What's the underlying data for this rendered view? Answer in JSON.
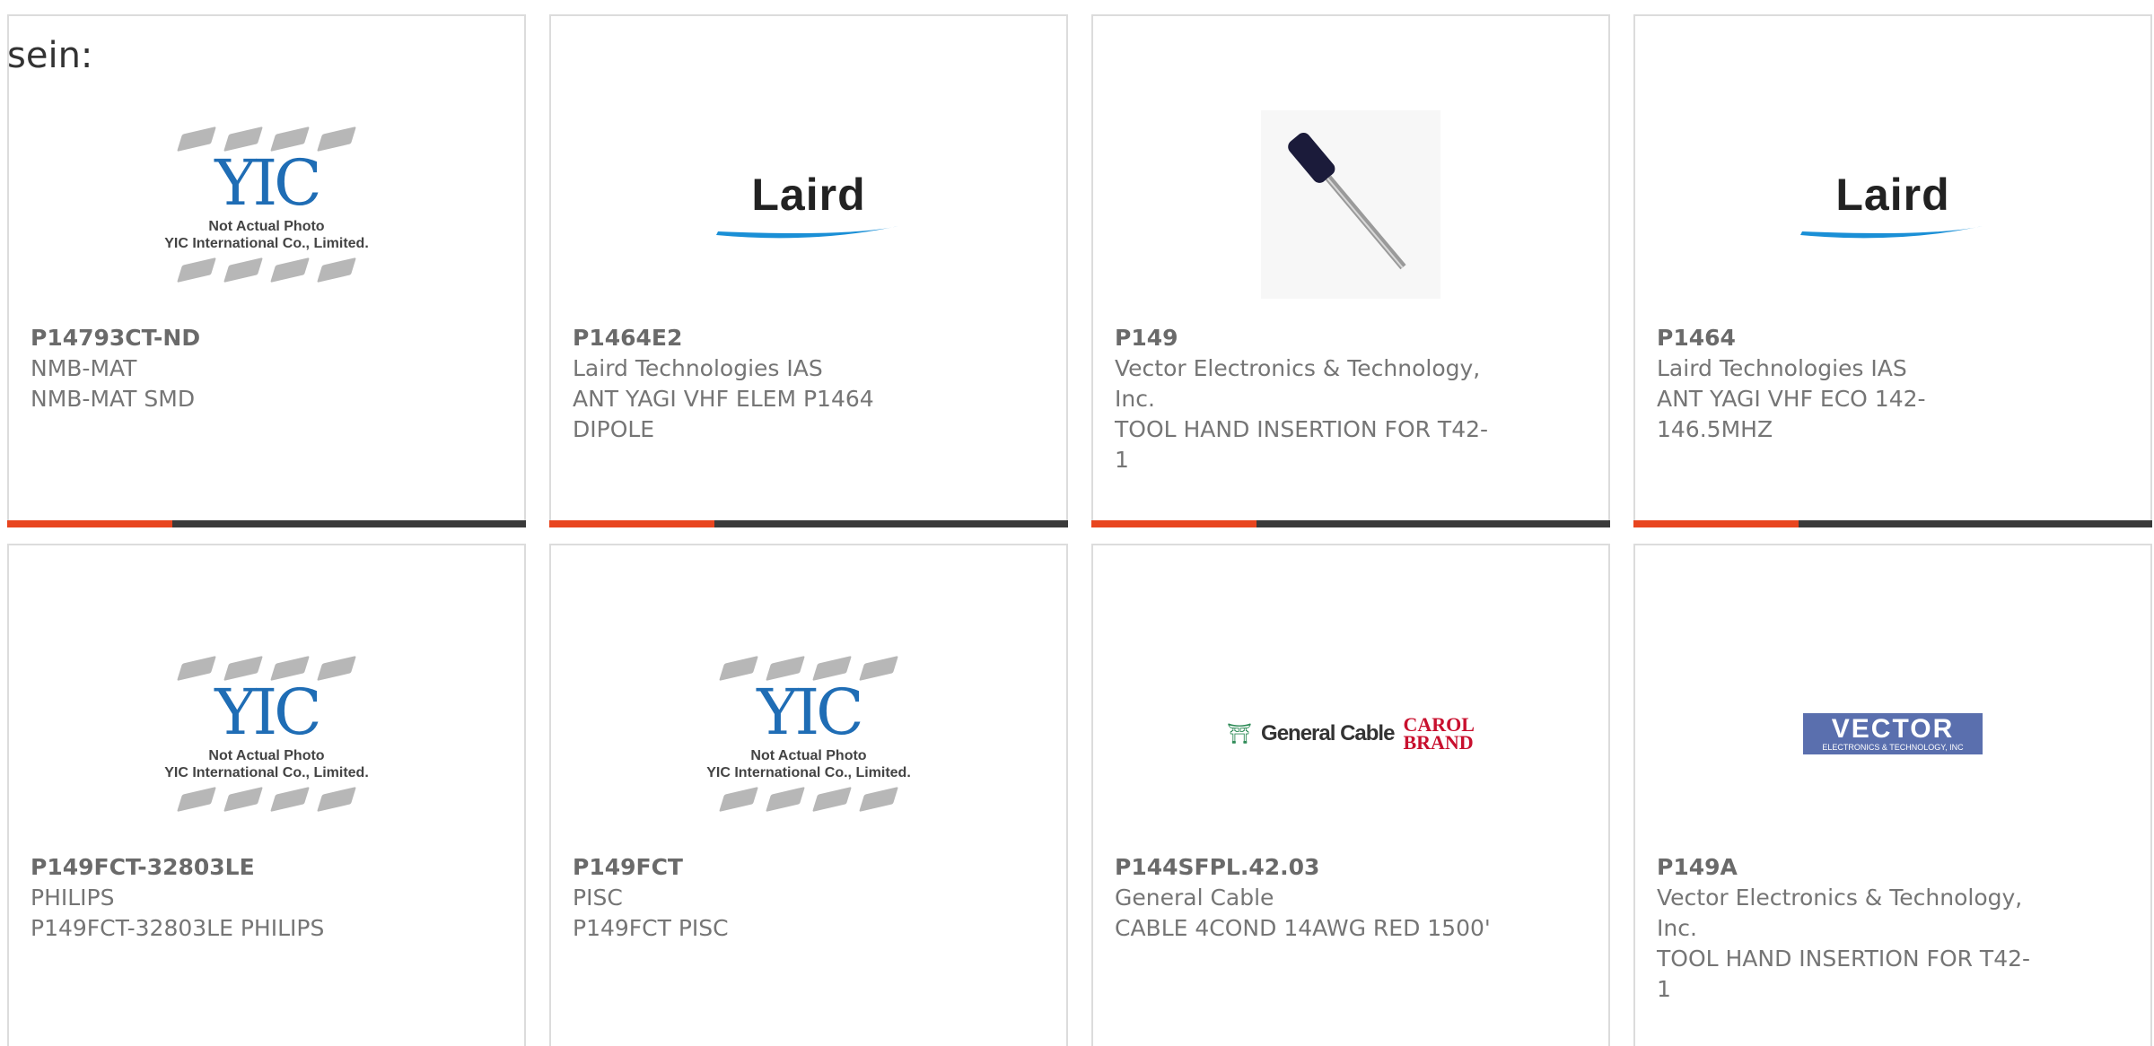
{
  "page_label": "sein:",
  "colors": {
    "accent": "#e8451f",
    "bar": "#3a3a3a",
    "border": "#dcdcdc",
    "text": "#757575"
  },
  "products": [
    {
      "part_number": "P14793CT-ND",
      "manufacturer": "NMB-MAT",
      "description": "NMB-MAT SMD",
      "image": "yic-placeholder"
    },
    {
      "part_number": "P1464E2",
      "manufacturer": "Laird Technologies IAS",
      "description": "ANT YAGI VHF ELEM P1464 DIPOLE",
      "image": "laird-logo"
    },
    {
      "part_number": "P149",
      "manufacturer": "Vector Electronics & Technology, Inc.",
      "description": "TOOL HAND INSERTION FOR T42-1",
      "image": "insertion-tool-photo"
    },
    {
      "part_number": "P1464",
      "manufacturer": "Laird Technologies IAS",
      "description": "ANT YAGI VHF ECO 142-146.5MHZ",
      "image": "laird-logo"
    },
    {
      "part_number": "P149FCT-32803LE",
      "manufacturer": "PHILIPS",
      "description": "P149FCT-32803LE PHILIPS",
      "image": "yic-placeholder"
    },
    {
      "part_number": "P149FCT",
      "manufacturer": "PISC",
      "description": "P149FCT PISC",
      "image": "yic-placeholder"
    },
    {
      "part_number": "P144SFPL.42.03",
      "manufacturer": "General Cable",
      "description": "CABLE 4COND 14AWG RED 1500'",
      "image": "general-cable-logo"
    },
    {
      "part_number": "P149A",
      "manufacturer": "Vector Electronics & Technology, Inc.",
      "description": "TOOL HAND INSERTION FOR T42-1",
      "image": "vector-logo"
    }
  ],
  "logos": {
    "laird": "Laird",
    "yic": "YIC",
    "yic_note_1": "Not Actual Photo",
    "yic_note_2": "YIC International Co., Limited.",
    "general_cable": "General Cable",
    "carol_1": "CAROL",
    "carol_2": "BRAND",
    "vector_1": "VECTOR",
    "vector_2": "ELECTRONICS & TECHNOLOGY, INC"
  }
}
